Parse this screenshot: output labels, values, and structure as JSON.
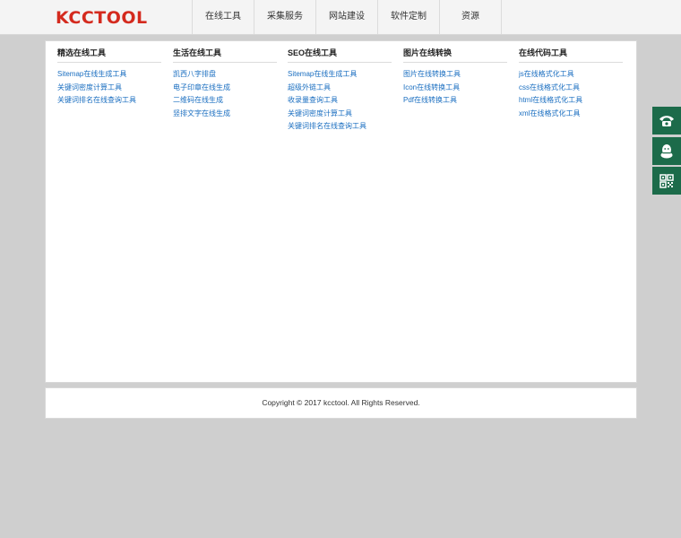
{
  "header": {
    "logo": "KCCTOOL",
    "nav": [
      "在线工具",
      "采集服务",
      "网站建设",
      "软件定制",
      "资源"
    ]
  },
  "columns": [
    {
      "title": "精选在线工具",
      "links": [
        "Sitemap在线生成工具",
        "关键词密度计算工具",
        "关键词排名在线查询工具"
      ]
    },
    {
      "title": "生活在线工具",
      "links": [
        "凯西八字排盘",
        "电子印章在线生成",
        "二维码在线生成",
        "竖排文字在线生成"
      ]
    },
    {
      "title": "SEO在线工具",
      "links": [
        "Sitemap在线生成工具",
        "超级外链工具",
        "收录量查询工具",
        "关键词密度计算工具",
        "关键词排名在线查询工具"
      ]
    },
    {
      "title": "图片在线转换",
      "links": [
        "图片在线转换工具",
        "Icon在线转换工具",
        "Pdf在线转换工具"
      ]
    },
    {
      "title": "在线代码工具",
      "links": [
        "js在线格式化工具",
        "css在线格式化工具",
        "html在线格式化工具",
        "xml在线格式化工具"
      ]
    }
  ],
  "footer": {
    "copyright": "Copyright © 2017 kcctool. All Rights Reserved."
  },
  "side_buttons": [
    "phone-icon",
    "qq-icon",
    "qrcode-icon"
  ],
  "colors": {
    "logo": "#d42a1e",
    "link": "#1a6ec0",
    "side": "#1c6b4a"
  }
}
